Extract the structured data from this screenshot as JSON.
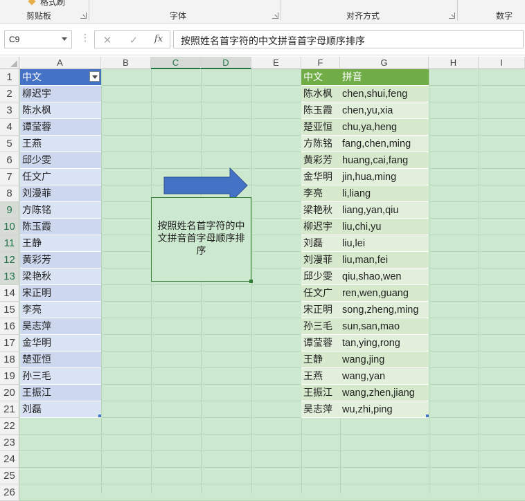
{
  "ribbon": {
    "groups": [
      {
        "label": "剪贴板"
      },
      {
        "label": "字体"
      },
      {
        "label": "对齐方式"
      },
      {
        "label": "数字"
      }
    ],
    "cut_text": "格式刷"
  },
  "formula_bar": {
    "name_box": "C9",
    "formula": "按照姓名首字符的中文拼音首字母顺序排序",
    "fx_label": "fx"
  },
  "columns": [
    "A",
    "B",
    "C",
    "D",
    "E",
    "F",
    "G",
    "H",
    "I"
  ],
  "rows": [
    "1",
    "2",
    "3",
    "4",
    "5",
    "6",
    "7",
    "8",
    "9",
    "10",
    "11",
    "12",
    "13",
    "14",
    "15",
    "16",
    "17",
    "18",
    "19",
    "20",
    "21",
    "22",
    "23",
    "24",
    "25",
    "26"
  ],
  "table_a": {
    "header": "中文",
    "values": [
      "柳迟宇",
      "陈水枫",
      "谭莹蓉",
      "王燕",
      "邱少雯",
      "任文广",
      "刘漫菲",
      "方陈铭",
      "陈玉霞",
      "王静",
      "黄彩芳",
      "梁艳秋",
      "宋正明",
      "李亮",
      "吴志萍",
      "金华明",
      "楚亚恒",
      "孙三毛",
      "王振江",
      "刘磊"
    ]
  },
  "table_fg": {
    "headers": [
      "中文",
      "拼音"
    ],
    "rows": [
      [
        "陈水枫",
        "chen,shui,feng"
      ],
      [
        "陈玉霞",
        "chen,yu,xia"
      ],
      [
        "楚亚恒",
        "chu,ya,heng"
      ],
      [
        "方陈铭",
        "fang,chen,ming"
      ],
      [
        "黄彩芳",
        "huang,cai,fang"
      ],
      [
        "金华明",
        "jin,hua,ming"
      ],
      [
        "李亮",
        "li,liang"
      ],
      [
        "梁艳秋",
        "liang,yan,qiu"
      ],
      [
        "柳迟宇",
        "liu,chi,yu"
      ],
      [
        "刘磊",
        "liu,lei"
      ],
      [
        "刘漫菲",
        "liu,man,fei"
      ],
      [
        "邱少雯",
        "qiu,shao,wen"
      ],
      [
        "任文广",
        "ren,wen,guang"
      ],
      [
        "宋正明",
        "song,zheng,ming"
      ],
      [
        "孙三毛",
        "sun,san,mao"
      ],
      [
        "谭莹蓉",
        "tan,ying,rong"
      ],
      [
        "王静",
        "wang,jing"
      ],
      [
        "王燕",
        "wang,yan"
      ],
      [
        "王振江",
        "wang,zhen,jiang"
      ],
      [
        "吴志萍",
        "wu,zhi,ping"
      ]
    ]
  },
  "text_box": "按照姓名首字符的中文拼音首字母顺序排序",
  "colors": {
    "sheet_bg": "#cce8cf",
    "table_a_header": "#4472c4",
    "table_a_band": "#dae3f3",
    "table_fg_header": "#70ad47",
    "table_fg_band": "#e2efda",
    "arrow": "#4472c4"
  }
}
